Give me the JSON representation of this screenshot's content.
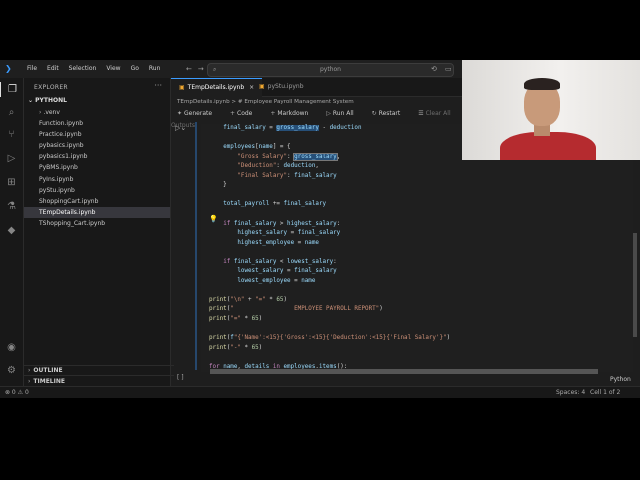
{
  "titlebar": {
    "menu": [
      "File",
      "Edit",
      "Selection",
      "View",
      "Go",
      "Run"
    ],
    "search_text": "python",
    "more": "···"
  },
  "sidebar": {
    "title": "EXPLORER",
    "more": "···",
    "folder": "PYTHONL",
    "items": [
      {
        "label": ".venv",
        "folder": true
      },
      {
        "label": "Function.ipynb"
      },
      {
        "label": "Practice.ipynb"
      },
      {
        "label": "pybasics.ipynb"
      },
      {
        "label": "pybasics1.ipynb"
      },
      {
        "label": "PyBMS.ipynb"
      },
      {
        "label": "PyIns.ipynb"
      },
      {
        "label": "pyStu.ipynb"
      },
      {
        "label": "ShoppingCart.ipynb"
      },
      {
        "label": "TEmpDetails.ipynb",
        "selected": true
      },
      {
        "label": "TShopping_Cart.ipynb"
      }
    ],
    "outline": "OUTLINE",
    "timeline": "TIMELINE"
  },
  "tabs": [
    {
      "label": "TEmpDetails.ipynb",
      "active": true
    },
    {
      "label": "pyStu.ipynb",
      "active": false
    }
  ],
  "breadcrumb": {
    "file": "TEmpDetails.ipynb",
    "sep": ">",
    "cell": "# Employee Payroll Management System"
  },
  "toolbar": {
    "generate": "Generate",
    "code": "Code",
    "markdown": "Markdown",
    "run_all": "Run All",
    "restart": "Restart",
    "clear": "Clear All Outputs",
    "more": "···"
  },
  "code_lines": [
    "    final_salary = gross_salary - deduction",
    "",
    "    employees[name] = {",
    "        \"Gross Salary\": gross_salary,",
    "        \"Deduction\": deduction,",
    "        \"Final Salary\": final_salary",
    "    }",
    "",
    "    total_payroll += final_salary",
    "",
    "    if final_salary > highest_salary:",
    "        highest_salary = final_salary",
    "        highest_employee = name",
    "",
    "    if final_salary < lowest_salary:",
    "        lowest_salary = final_salary",
    "        lowest_employee = name",
    "",
    "print(\"\\n\" + \"=\" * 65)",
    "print(\"                 EMPLOYEE PAYROLL REPORT\")",
    "print(\"=\" * 65)",
    "",
    "print(f\"{'Name':<15}{'Gross':<15}{'Deduction':<15}{'Final Salary'}\")",
    "print(\"-\" * 65)",
    "",
    "for name, details in employees.items():"
  ],
  "cell_index": "[ ]",
  "language": "Python",
  "status": {
    "left": "⊗ 0  ⚠ 0",
    "spaces": "Spaces: 4",
    "cell": "Cell 1 of 2"
  }
}
